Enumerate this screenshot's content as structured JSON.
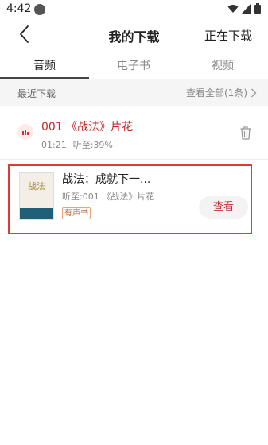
{
  "status_bar": {
    "time": "4:42",
    "app_icon": "app-notification-icon",
    "icons": [
      "wifi-icon",
      "signal-icon",
      "battery-icon"
    ]
  },
  "header": {
    "back_icon": "back-arrow-icon",
    "title": "我的下载",
    "downloading_label": "正在下载"
  },
  "tabs": [
    {
      "label": "音频",
      "active": true
    },
    {
      "label": "电子书",
      "active": false
    },
    {
      "label": "视频",
      "active": false
    }
  ],
  "section": {
    "title": "最近下载",
    "view_all": "查看全部(1条)",
    "view_all_icon": "chevron-right-icon"
  },
  "downloaded_episode": {
    "icon": "audio-bars-icon",
    "title": "001 《战法》片花",
    "duration": "01:21",
    "progress": "听至:39%",
    "delete_icon": "trash-icon"
  },
  "book_card": {
    "cover_text": "战法",
    "title": "战法：成就下一...",
    "progress": "听至:001 《战法》片花",
    "tag": "有声书",
    "view_button": "查看"
  },
  "colors": {
    "accent": "#c62828",
    "highlight_border": "#e53935",
    "tag": "#c8692b"
  }
}
